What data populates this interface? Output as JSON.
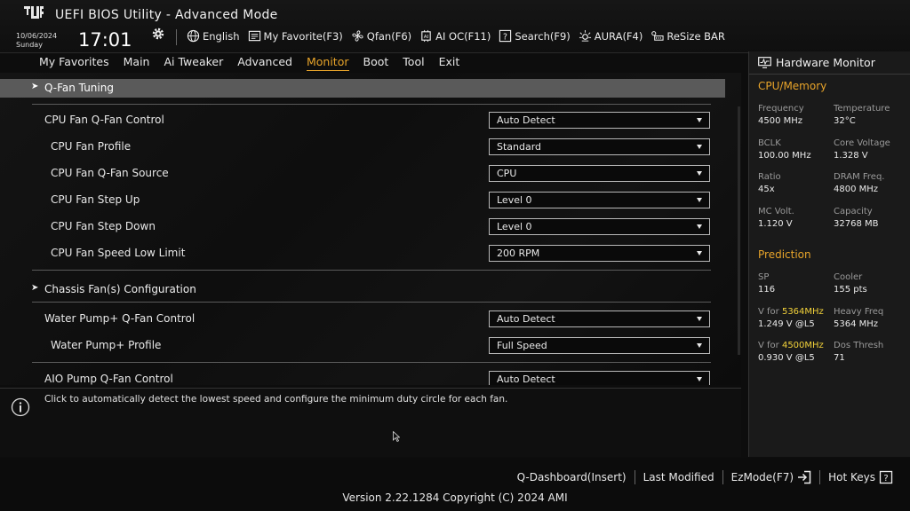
{
  "window": {
    "title": "UEFI BIOS Utility - Advanced Mode"
  },
  "status": {
    "date": "10/06/2024",
    "day": "Sunday",
    "time": "17:01"
  },
  "toolbar": [
    {
      "name": "language",
      "label": "English",
      "icon": "globe-icon"
    },
    {
      "name": "my-favorite",
      "label": "My Favorite(F3)",
      "icon": "favorite-icon"
    },
    {
      "name": "qfan",
      "label": "Qfan(F6)",
      "icon": "fan-icon"
    },
    {
      "name": "ai-oc",
      "label": "AI OC(F11)",
      "icon": "ai-oc-icon"
    },
    {
      "name": "search",
      "label": "Search(F9)",
      "icon": "search-icon"
    },
    {
      "name": "aura",
      "label": "AURA(F4)",
      "icon": "aura-icon"
    },
    {
      "name": "resize-bar",
      "label": "ReSize BAR",
      "icon": "resize-bar-icon"
    }
  ],
  "menu": [
    {
      "label": "My Favorites",
      "active": false
    },
    {
      "label": "Main",
      "active": false
    },
    {
      "label": "Ai Tweaker",
      "active": false
    },
    {
      "label": "Advanced",
      "active": false
    },
    {
      "label": "Monitor",
      "active": true
    },
    {
      "label": "Boot",
      "active": false
    },
    {
      "label": "Tool",
      "active": false
    },
    {
      "label": "Exit",
      "active": false
    }
  ],
  "main": {
    "section1": "Q-Fan Tuning",
    "section2": "Chassis Fan(s) Configuration",
    "rows": [
      {
        "label": "CPU Fan Q-Fan Control",
        "value": "Auto Detect"
      },
      {
        "label": "CPU Fan Profile",
        "value": "Standard"
      },
      {
        "label": "CPU Fan Q-Fan Source",
        "value": "CPU"
      },
      {
        "label": "CPU Fan Step Up",
        "value": "Level 0"
      },
      {
        "label": "CPU Fan Step Down",
        "value": "Level 0"
      },
      {
        "label": "CPU Fan Speed Low Limit",
        "value": "200 RPM"
      },
      {
        "label": "Water Pump+ Q-Fan Control",
        "value": "Auto Detect"
      },
      {
        "label": "Water Pump+ Profile",
        "value": "Full Speed"
      },
      {
        "label": "AIO Pump Q-Fan Control",
        "value": "Auto Detect"
      }
    ]
  },
  "help": {
    "text": "Click to automatically detect the lowest speed and configure the minimum duty circle for each fan."
  },
  "hardware_monitor": {
    "title": "Hardware Monitor",
    "cpu_memory_title": "CPU/Memory",
    "cpu": [
      {
        "key": "Frequency",
        "value": "4500 MHz"
      },
      {
        "key": "Temperature",
        "value": "32°C"
      },
      {
        "key": "BCLK",
        "value": "100.00 MHz"
      },
      {
        "key": "Core Voltage",
        "value": "1.328 V"
      },
      {
        "key": "Ratio",
        "value": "45x"
      },
      {
        "key": "DRAM Freq.",
        "value": "4800 MHz"
      },
      {
        "key": "MC Volt.",
        "value": "1.120 V"
      },
      {
        "key": "Capacity",
        "value": "32768 MB"
      }
    ],
    "prediction_title": "Prediction",
    "prediction": {
      "sp_key": "SP",
      "sp_value": "116",
      "cooler_key": "Cooler",
      "cooler_value": "155 pts",
      "v1_prefix": "V for ",
      "v1_freq": "5364MHz",
      "v1_value": "1.249 V @L5",
      "heavy_key": "Heavy Freq",
      "heavy_value": "5364 MHz",
      "v2_prefix": "V for ",
      "v2_freq": "4500MHz",
      "v2_value": "0.930 V @L5",
      "dos_key": "Dos Thresh",
      "dos_value": "71"
    }
  },
  "footer": {
    "qdashboard": "Q-Dashboard(Insert)",
    "last_modified": "Last Modified",
    "ezmode": "EzMode(F7)",
    "hotkeys": "Hot Keys",
    "version": "Version 2.22.1284 Copyright (C) 2024 AMI"
  },
  "colors": {
    "accent": "#e8a42a",
    "highlight": "#f3d23a",
    "section_bar": "#5a5a5a"
  }
}
